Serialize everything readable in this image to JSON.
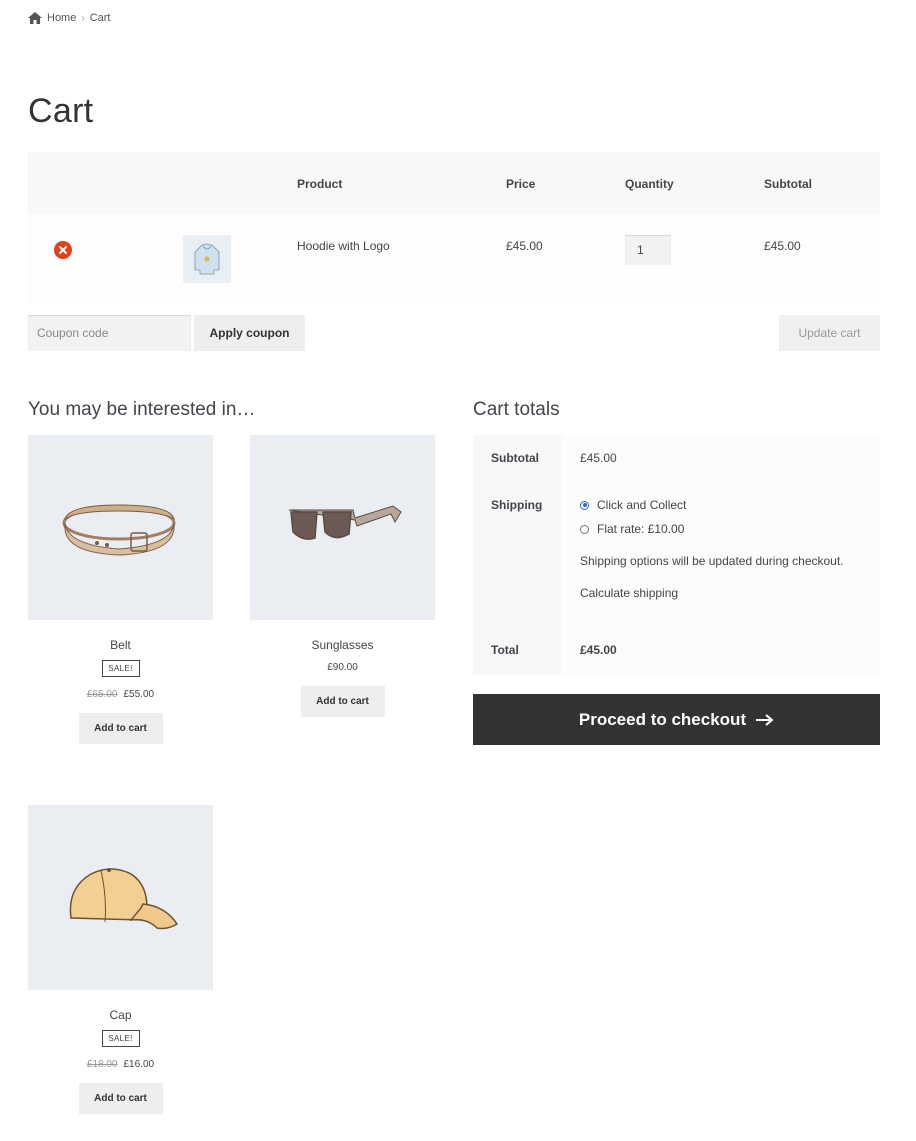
{
  "breadcrumb": {
    "home": "Home",
    "current": "Cart",
    "separator": "›"
  },
  "page_title": "Cart",
  "cart_table": {
    "headers": {
      "product": "Product",
      "price": "Price",
      "quantity": "Quantity",
      "subtotal": "Subtotal"
    },
    "rows": [
      {
        "product": "Hoodie with Logo",
        "price": "£45.00",
        "quantity": "1",
        "subtotal": "£45.00"
      }
    ]
  },
  "coupon": {
    "placeholder": "Coupon code",
    "apply_label": "Apply coupon",
    "update_label": "Update cart"
  },
  "related": {
    "heading": "You may be interested in…",
    "products": [
      {
        "name": "Belt",
        "sale_badge": "SALE!",
        "old_price": "£65.00",
        "price": "£55.00",
        "button": "Add to cart"
      },
      {
        "name": "Sunglasses",
        "price": "£90.00",
        "button": "Add to cart"
      },
      {
        "name": "Cap",
        "sale_badge": "SALE!",
        "old_price": "£18.00",
        "price": "£16.00",
        "button": "Add to cart"
      }
    ]
  },
  "totals": {
    "heading": "Cart totals",
    "subtotal_label": "Subtotal",
    "subtotal_value": "£45.00",
    "shipping_label": "Shipping",
    "shipping_options": [
      {
        "label": "Click and Collect",
        "selected": true
      },
      {
        "label": "Flat rate: £10.00",
        "selected": false
      }
    ],
    "shipping_note": "Shipping options will be updated during checkout.",
    "calculate_label": "Calculate shipping",
    "total_label": "Total",
    "total_value": "£45.00",
    "checkout_label": "Proceed to checkout"
  },
  "colors": {
    "remove": "#e2401c",
    "checkout_bg": "#333333",
    "image_bg": "#eaeef3",
    "radio_selected": "#2563eb"
  }
}
